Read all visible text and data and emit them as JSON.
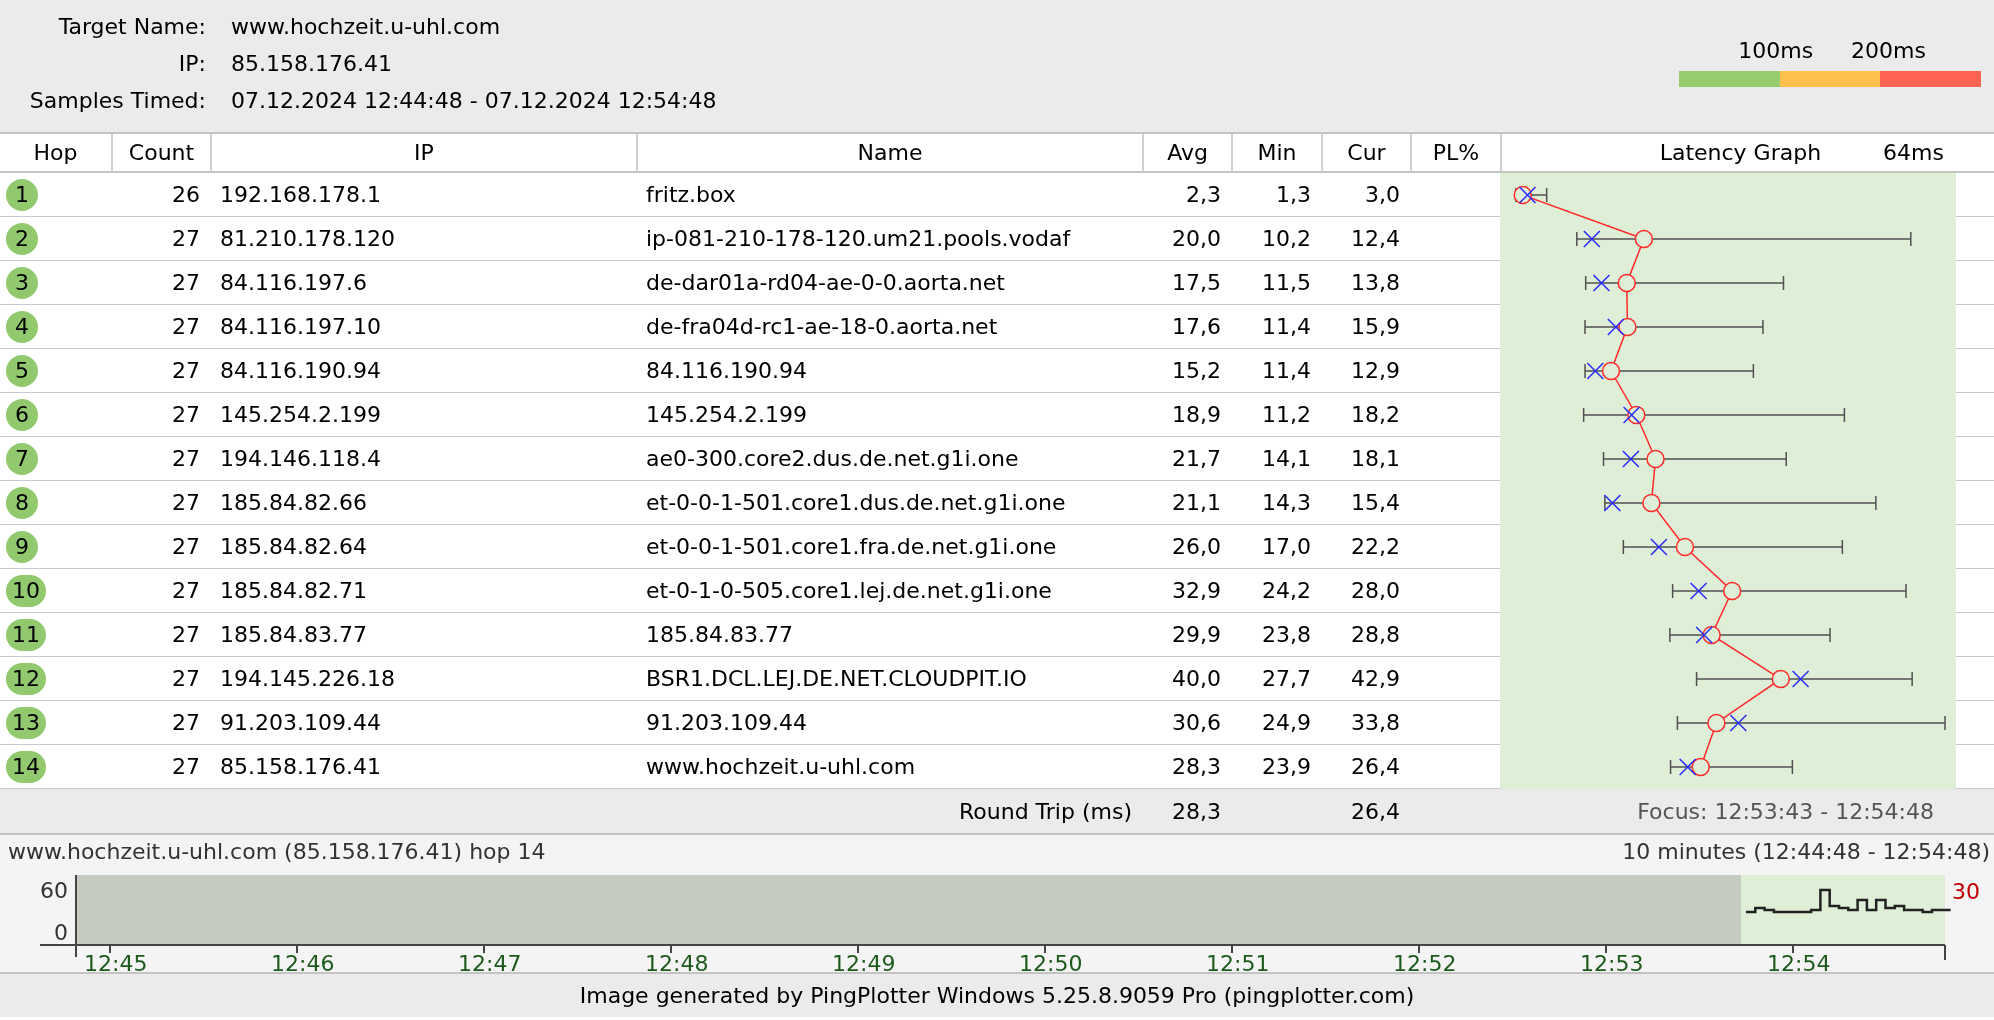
{
  "target": {
    "fields": [
      {
        "label": "Target Name:",
        "value": "www.hochzeit.u-uhl.com"
      },
      {
        "label": "IP:",
        "value": "85.158.176.41"
      },
      {
        "label": "Samples Timed:",
        "value": "07.12.2024 12:44:48 - 07.12.2024 12:54:48"
      }
    ]
  },
  "legend": {
    "labels": [
      "100ms",
      "200ms"
    ],
    "segments": [
      {
        "color": "#96cb6e"
      },
      {
        "color": "#ffc04d"
      },
      {
        "color": "#fd6552"
      }
    ]
  },
  "table": {
    "columns": [
      "Hop",
      "Count",
      "IP",
      "Name",
      "Avg",
      "Min",
      "Cur",
      "PL%"
    ],
    "graph_title": "Latency Graph",
    "graph_scale": "64ms",
    "rows": [
      {
        "hop": "1",
        "count": "26",
        "ip": "192.168.178.1",
        "name": "fritz.box",
        "avg": "2,3",
        "min": "1,3",
        "cur": "3,0"
      },
      {
        "hop": "2",
        "count": "27",
        "ip": "81.210.178.120",
        "name": "ip-081-210-178-120.um21.pools.vodaf",
        "avg": "20,0",
        "min": "10,2",
        "cur": "12,4"
      },
      {
        "hop": "3",
        "count": "27",
        "ip": "84.116.197.6",
        "name": "de-dar01a-rd04-ae-0-0.aorta.net",
        "avg": "17,5",
        "min": "11,5",
        "cur": "13,8"
      },
      {
        "hop": "4",
        "count": "27",
        "ip": "84.116.197.10",
        "name": "de-fra04d-rc1-ae-18-0.aorta.net",
        "avg": "17,6",
        "min": "11,4",
        "cur": "15,9"
      },
      {
        "hop": "5",
        "count": "27",
        "ip": "84.116.190.94",
        "name": "84.116.190.94",
        "avg": "15,2",
        "min": "11,4",
        "cur": "12,9"
      },
      {
        "hop": "6",
        "count": "27",
        "ip": "145.254.2.199",
        "name": "145.254.2.199",
        "avg": "18,9",
        "min": "11,2",
        "cur": "18,2"
      },
      {
        "hop": "7",
        "count": "27",
        "ip": "194.146.118.4",
        "name": "ae0-300.core2.dus.de.net.g1i.one",
        "avg": "21,7",
        "min": "14,1",
        "cur": "18,1"
      },
      {
        "hop": "8",
        "count": "27",
        "ip": "185.84.82.66",
        "name": "et-0-0-1-501.core1.dus.de.net.g1i.one",
        "avg": "21,1",
        "min": "14,3",
        "cur": "15,4"
      },
      {
        "hop": "9",
        "count": "27",
        "ip": "185.84.82.64",
        "name": "et-0-0-1-501.core1.fra.de.net.g1i.one",
        "avg": "26,0",
        "min": "17,0",
        "cur": "22,2"
      },
      {
        "hop": "10",
        "count": "27",
        "ip": "185.84.82.71",
        "name": "et-0-1-0-505.core1.lej.de.net.g1i.one",
        "avg": "32,9",
        "min": "24,2",
        "cur": "28,0"
      },
      {
        "hop": "11",
        "count": "27",
        "ip": "185.84.83.77",
        "name": "185.84.83.77",
        "avg": "29,9",
        "min": "23,8",
        "cur": "28,8"
      },
      {
        "hop": "12",
        "count": "27",
        "ip": "194.145.226.18",
        "name": "BSR1.DCL.LEJ.DE.NET.CLOUDPIT.IO",
        "avg": "40,0",
        "min": "27,7",
        "cur": "42,9"
      },
      {
        "hop": "13",
        "count": "27",
        "ip": "91.203.109.44",
        "name": "91.203.109.44",
        "avg": "30,6",
        "min": "24,9",
        "cur": "33,8"
      },
      {
        "hop": "14",
        "count": "27",
        "ip": "85.158.176.41",
        "name": "www.hochzeit.u-uhl.com",
        "avg": "28,3",
        "min": "23,9",
        "cur": "26,4"
      }
    ]
  },
  "round_trip": {
    "label": "Round Trip (ms)",
    "avg": "28,3",
    "cur": "26,4",
    "focus": "Focus: 12:53:43 - 12:54:48"
  },
  "timeline": {
    "title": "www.hochzeit.u-uhl.com (85.158.176.41) hop 14",
    "range": "10 minutes (12:44:48 - 12:54:48)",
    "y_labels": [
      "60",
      "0"
    ],
    "peak": "30",
    "x_labels": [
      "12:45",
      "12:46",
      "12:47",
      "12:48",
      "12:49",
      "12:50",
      "12:51",
      "12:52",
      "12:53",
      "12:54"
    ]
  },
  "footer": "Image generated by PingPlotter Windows 5.25.8.9059 Pro (pingplotter.com)"
}
